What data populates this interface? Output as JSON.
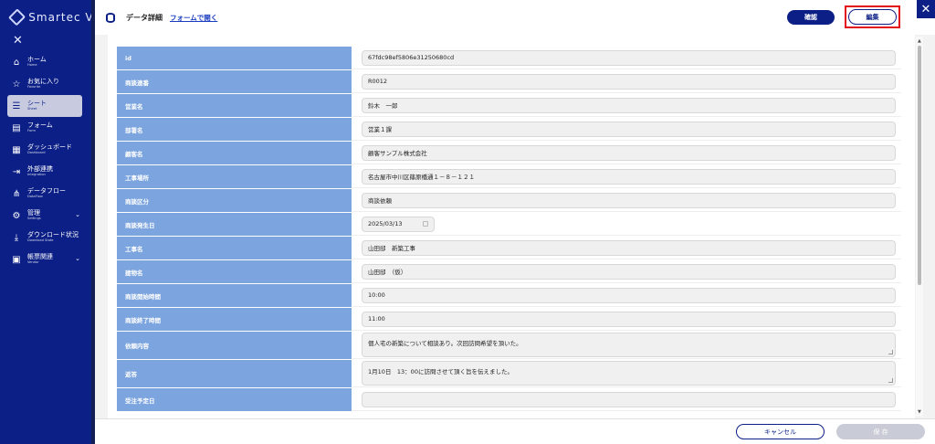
{
  "brand": {
    "name": "Smartec Visi"
  },
  "sidebar": {
    "close_glyph": "✕",
    "items": [
      {
        "label": "ホーム",
        "sub": "Home",
        "icon": "home-icon",
        "glyph": "⌂",
        "active": false,
        "chevron": false
      },
      {
        "label": "お気に入り",
        "sub": "Favorite",
        "icon": "star-icon",
        "glyph": "☆",
        "active": false,
        "chevron": false
      },
      {
        "label": "シート",
        "sub": "Sheet",
        "icon": "database-icon",
        "glyph": "☰",
        "active": true,
        "chevron": false
      },
      {
        "label": "フォーム",
        "sub": "Form",
        "icon": "form-icon",
        "glyph": "▤",
        "active": false,
        "chevron": false
      },
      {
        "label": "ダッシュボード",
        "sub": "Dashboard",
        "icon": "dashboard-icon",
        "glyph": "▦",
        "active": false,
        "chevron": false
      },
      {
        "label": "外部連携",
        "sub": "Integration",
        "icon": "integration-icon",
        "glyph": "⇥",
        "active": false,
        "chevron": false
      },
      {
        "label": "データフロー",
        "sub": "DataFlow",
        "icon": "dataflow-icon",
        "glyph": "⋔",
        "active": false,
        "chevron": false
      },
      {
        "label": "管理",
        "sub": "Settings",
        "icon": "gear-icon",
        "glyph": "⚙",
        "active": false,
        "chevron": true
      },
      {
        "label": "ダウンロード状況",
        "sub": "Download State",
        "icon": "download-icon",
        "glyph": "⤓",
        "active": false,
        "chevron": false
      },
      {
        "label": "帳票関連",
        "sub": "Vendor",
        "icon": "report-icon",
        "glyph": "▣",
        "active": false,
        "chevron": true
      }
    ]
  },
  "header": {
    "title": "データ詳細",
    "open_form_link": "フォームで開く",
    "confirm_label": "確認",
    "edit_label": "編集",
    "close_glyph": "✕"
  },
  "fields": [
    {
      "label": "id",
      "value": "67fdc98ef5806e31250680cd",
      "type": "text"
    },
    {
      "label": "商談連番",
      "value": "R0012",
      "type": "text"
    },
    {
      "label": "営業名",
      "value": "鈴木　一郎",
      "type": "text"
    },
    {
      "label": "部署名",
      "value": "営業１課",
      "type": "text"
    },
    {
      "label": "顧客名",
      "value": "顧客サンプル株式会社",
      "type": "text"
    },
    {
      "label": "工事場所",
      "value": "名古屋市中川区篠原橋通１－８－１２１",
      "type": "text"
    },
    {
      "label": "商談区分",
      "value": "商談依頼",
      "type": "text"
    },
    {
      "label": "商談発生日",
      "value": "2025/03/13",
      "type": "date"
    },
    {
      "label": "工事名",
      "value": "山田邸　新築工事",
      "type": "text"
    },
    {
      "label": "建物名",
      "value": "山田邸　（仮）",
      "type": "text"
    },
    {
      "label": "商談開始時間",
      "value": "10:00",
      "type": "text"
    },
    {
      "label": "商談終了時間",
      "value": "11:00",
      "type": "text"
    },
    {
      "label": "依頼内容",
      "value": "個人宅の新築について相談あり。次回訪問希望を頂いた。",
      "type": "textarea"
    },
    {
      "label": "返答",
      "value": "1月10日　13：00に訪問させて頂く旨を伝えました。",
      "type": "textarea"
    },
    {
      "label": "受注予定日",
      "value": "",
      "type": "text"
    }
  ],
  "footer": {
    "cancel_label": "キャンセル",
    "save_label": "保 存"
  },
  "colors": {
    "sidebar_bg": "#0b1f86",
    "label_bg": "#7ca4de",
    "highlight": "#e2101a"
  }
}
